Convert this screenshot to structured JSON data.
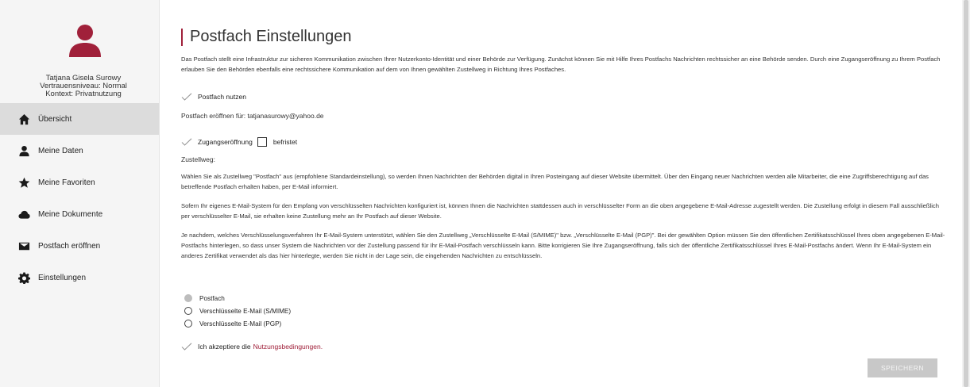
{
  "colors": {
    "accent": "#a0203a",
    "sidebar_bg": "#f5f5f5",
    "active_nav_bg": "#dcdcdc",
    "button_disabled": "#c8c8c8"
  },
  "profile": {
    "avatar_icon": "person-icon",
    "name": "Tatjana Gisela Surowy",
    "trust_level": "Vertrauensniveau: Normal",
    "context": "Kontext: Privatnutzung"
  },
  "nav": {
    "items": [
      {
        "label": "Übersicht",
        "icon": "home-icon",
        "active": true
      },
      {
        "label": "Meine Daten",
        "icon": "person-icon",
        "active": false
      },
      {
        "label": "Meine Favoriten",
        "icon": "star-icon",
        "active": false
      },
      {
        "label": "Meine Dokumente",
        "icon": "cloud-icon",
        "active": false
      },
      {
        "label": "Postfach eröffnen",
        "icon": "mail-icon",
        "active": false
      },
      {
        "label": "Einstellungen",
        "icon": "gear-icon",
        "active": false
      }
    ]
  },
  "main": {
    "title": "Postfach Einstellungen",
    "intro": "Das Postfach stellt eine Infrastruktur zur sicheren Kommunikation zwischen Ihrer Nutzerkonto-Identität und einer Behörde zur Verfügung. Zunächst können Sie mit Hilfe Ihres Postfachs Nachrichten rechtssicher an eine Behörde senden. Durch eine Zugangseröffnung zu Ihrem Postfach erlauben Sie den Behörden ebenfalls eine rechtssichere Kommunikation auf dem von Ihnen gewählten Zustellweg in Richtung Ihres Postfaches.",
    "postfach_nutzen_label": "Postfach nutzen",
    "open_for": "Postfach eröffnen für: tatjanasurowy@yahoo.de",
    "zugang_label": "Zugangseröffnung",
    "befristet_label": "befristet",
    "zustellweg_label": "Zustellweg:",
    "p1": "Wählen Sie als Zustellweg \"Postfach\" aus (empfohlene Standardeinstellung), so werden Ihnen Nachrichten der Behörden digital in Ihren Posteingang auf dieser Website übermittelt. Über den Eingang neuer Nachrichten werden alle Mitarbeiter, die eine Zugriffsberechtigung auf das betreffende Postfach erhalten haben, per E-Mail informiert.",
    "p2": "Sofern Ihr eigenes E-Mail-System für den Empfang von verschlüsselten Nachrichten konfiguriert ist, können Ihnen die Nachrichten stattdessen auch in verschlüsselter Form an die oben angegebene E-Mail-Adresse zugestellt werden. Die Zustellung erfolgt in diesem Fall ausschließlich per verschlüsselter E-Mail, sie erhalten keine Zustellung mehr an Ihr Postfach auf dieser Website.",
    "p3": "Je nachdem, welches Verschlüsselungsverfahren Ihr E-Mail-System unterstützt, wählen Sie den Zustellweg „Verschlüsselte E-Mail (S/MIME)\" bzw. „Verschlüsselte E-Mail (PGP)\". Bei der gewählten Option müssen Sie den öffentlichen Zertifikatsschlüssel Ihres oben angegebenen E-Mail-Postfachs hinterlegen, so dass unser System die Nachrichten vor der Zustellung passend für Ihr E-Mail-Postfach verschlüsseln kann. Bitte korrigieren Sie Ihre Zugangseröffnung, falls sich der öffentliche Zertifikatsschlüssel Ihres E-Mail-Postfachs ändert. Wenn Ihr E-Mail-System ein anderes Zertifikat verwendet als das hier hinterlegte, werden Sie nicht in der Lage sein, die eingehenden Nachrichten zu entschlüsseln.",
    "radio_options": [
      {
        "label": "Postfach",
        "selected": true
      },
      {
        "label": "Verschlüsselte E-Mail (S/MIME)",
        "selected": false
      },
      {
        "label": "Verschlüsselte E-Mail (PGP)",
        "selected": false
      }
    ],
    "accept_prefix": "Ich akzeptiere die",
    "accept_link": "Nutzungsbedingungen.",
    "save_label": "SPEICHERN"
  }
}
